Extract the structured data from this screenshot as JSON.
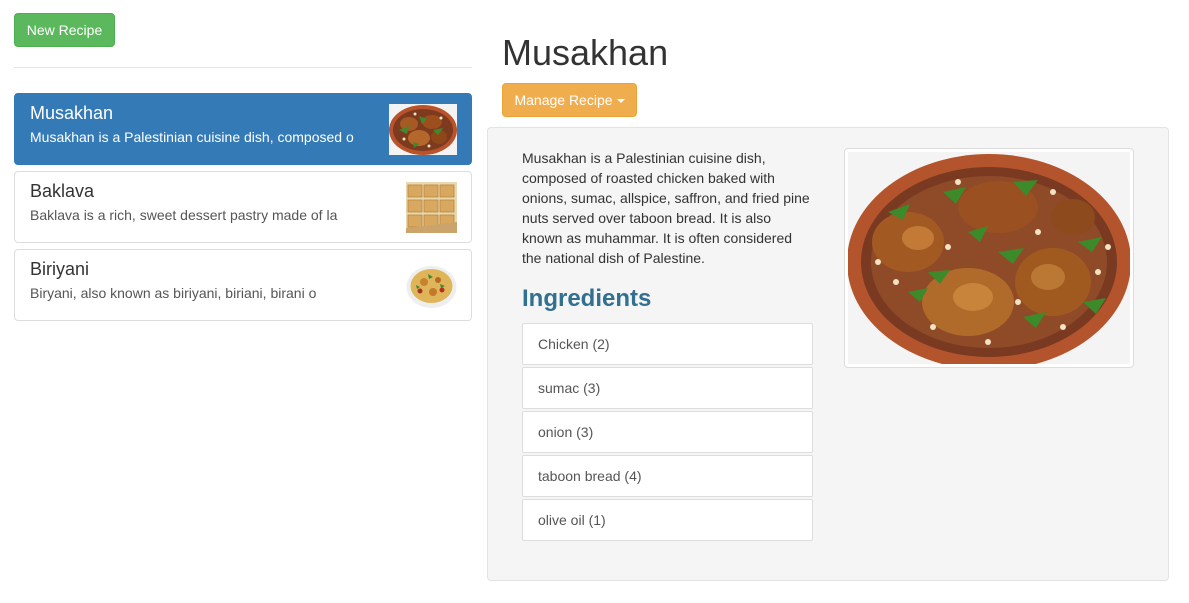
{
  "toolbar": {
    "new_recipe_label": "New Recipe"
  },
  "recipes": [
    {
      "title": "Musakhan",
      "snippet": "Musakhan is a Palestinian cuisine dish, composed o",
      "thumb_icon": "musakhan-thumbnail"
    },
    {
      "title": "Baklava",
      "snippet": "Baklava is a rich, sweet dessert pastry made of la",
      "thumb_icon": "baklava-thumbnail"
    },
    {
      "title": "Biriyani",
      "snippet": "Biryani, also known as biriyani, biriani, birani o",
      "thumb_icon": "biriyani-thumbnail"
    }
  ],
  "detail": {
    "title": "Musakhan",
    "manage_label": "Manage Recipe",
    "description": "Musakhan is a Palestinian cuisine dish, composed of roasted chicken baked with onions, sumac, allspice, saffron, and fried pine nuts served over taboon bread. It is also known as muhammar. It is often considered the national dish of Palestine.",
    "ingredients_heading": "Ingredients",
    "ingredients": [
      "Chicken (2)",
      "sumac (3)",
      "onion (3)",
      "taboon bread (4)",
      "olive oil (1)"
    ]
  },
  "colors": {
    "primary": "#337ab7",
    "success": "#5cb85c",
    "warning": "#f0ad4e",
    "heading_blue": "#31708f"
  }
}
